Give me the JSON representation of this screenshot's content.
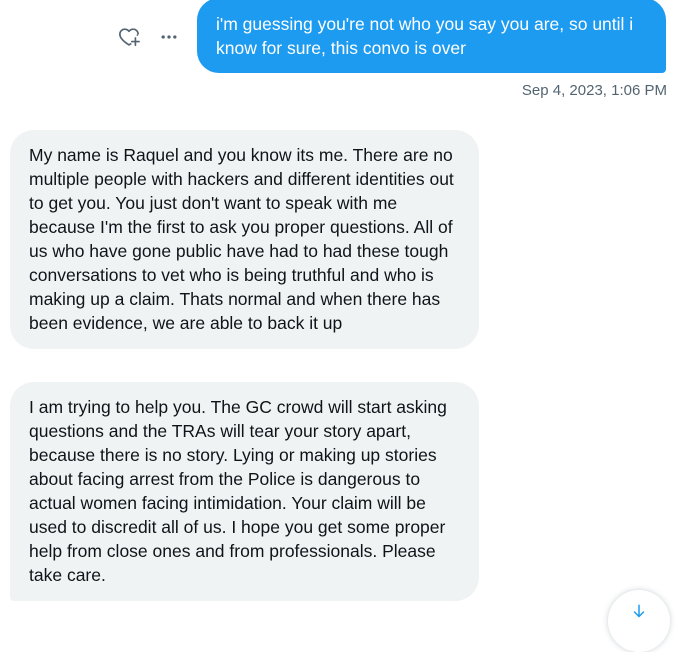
{
  "sent_message": {
    "text": "i'm guessing you're not who you say you are, so until i know for sure, this convo is over",
    "timestamp": "Sep 4, 2023, 1:06 PM"
  },
  "received_messages": [
    {
      "text": "My name is Raquel and you know its me. There are no multiple people with hackers and different identities out to get you. You just don't want to speak with me because I'm the first to ask you proper questions. All of us who have gone public have had to had these tough conversations to vet who is being truthful and who is making up a claim. Thats normal and when there has been evidence, we are able to back it up"
    },
    {
      "text": "I am trying to help you. The GC crowd will start asking questions and the TRAs will tear your story apart, because there is no story. Lying or making up stories about facing arrest from the Police is dangerous to actual women facing intimidation. Your claim will be used to discredit all of us. I hope you get some proper help from close ones and from professionals. Please take care."
    }
  ],
  "icons": {
    "react": "heart-plus-icon",
    "more": "more-horizontal-icon",
    "scroll": "arrow-down-icon"
  },
  "colors": {
    "sent_bubble": "#1d9bf0",
    "received_bubble": "#eff3f4",
    "timestamp": "#536471",
    "icon": "#536471"
  }
}
